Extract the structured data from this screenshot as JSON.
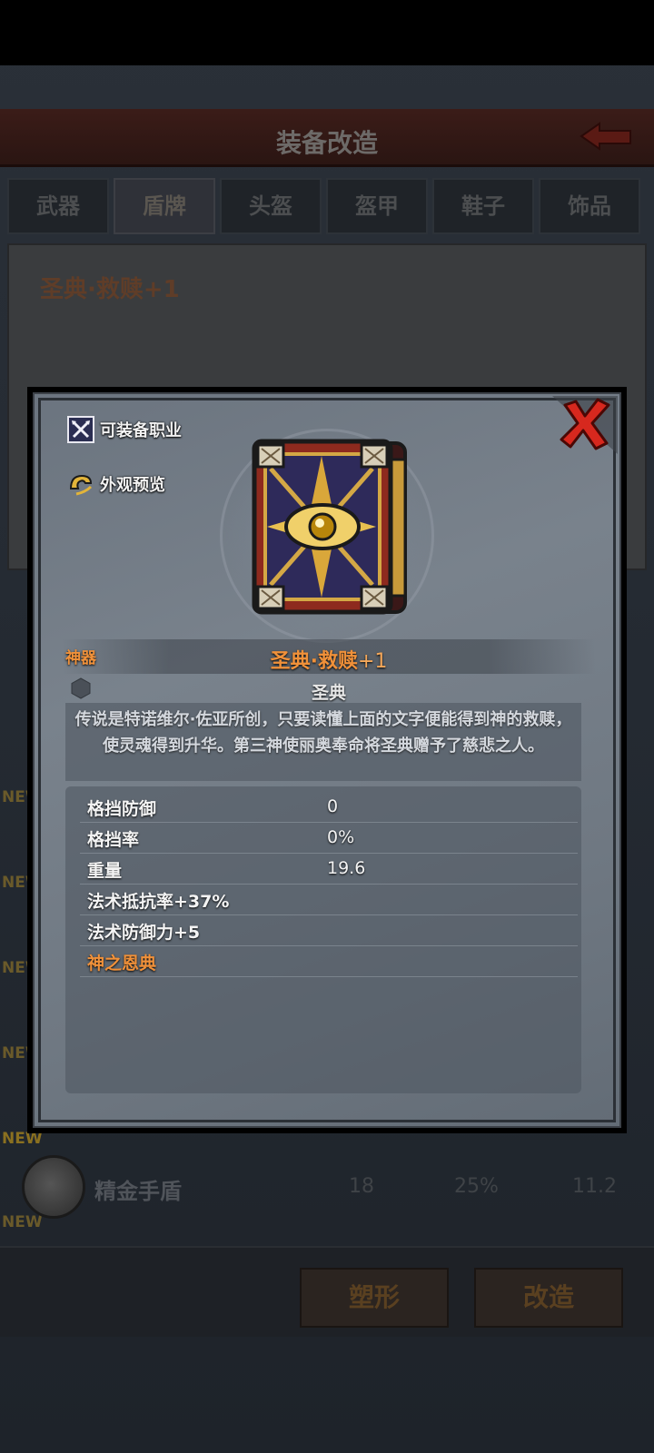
{
  "background": {
    "title": "装备改造",
    "tabs": [
      "武器",
      "盾牌",
      "头盔",
      "盔甲",
      "鞋子",
      "饰品"
    ],
    "active_tab": "盾牌",
    "selected_item": "圣典·救赎+1",
    "new_label": "NEW",
    "list_row": {
      "name": "精金手盾",
      "values": [
        "18",
        "25%",
        "11.2"
      ]
    },
    "buttons": {
      "reshape": "塑形",
      "modify": "改造"
    }
  },
  "modal": {
    "options": {
      "equip_class": "可装备职业",
      "appearance_preview": "外观预览"
    },
    "item": {
      "category": "神器",
      "name": "圣典·救赎",
      "plus": "+1",
      "subtype": "圣典",
      "description": "传说是特诺维尔·佐亚所创，只要读懂上面的文字便能得到神的救赎，使灵魂得到升华。第三神使丽奥奉命将圣典赠予了慈悲之人。"
    },
    "stats": [
      {
        "label": "格挡防御",
        "value": "0"
      },
      {
        "label": "格挡率",
        "value": "0%"
      },
      {
        "label": "重量",
        "value": "19.6"
      },
      {
        "label": "法术抵抗率+37%",
        "value": ""
      },
      {
        "label": "法术防御力+5",
        "value": ""
      },
      {
        "label": "神之恩典",
        "value": ""
      }
    ]
  },
  "icons": {
    "close": "close-x-icon",
    "class": "crossed-weapons-icon",
    "preview": "appearance-icon",
    "item": "holy-book-icon",
    "hex": "hexagon-gem-icon",
    "back": "back-arrow-icon"
  },
  "colors": {
    "accent_orange": "#f0913a",
    "close_red": "#d7281e"
  }
}
